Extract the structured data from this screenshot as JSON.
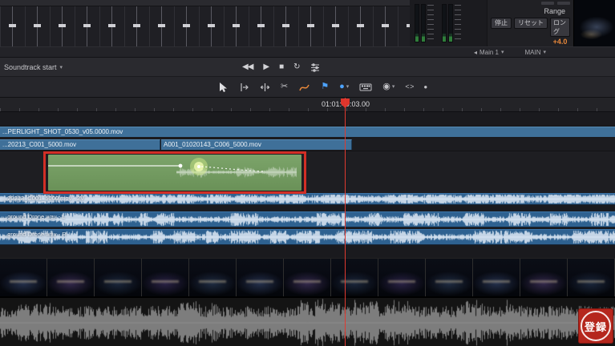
{
  "header": {
    "soundtrack_label": "Soundtrack start",
    "range_label": "Range",
    "stop_button": "停止",
    "reset_button": "リセット",
    "long_button": "ロング",
    "long_value": "+4.0",
    "main1_bus": "Main 1",
    "main_bus": "MAIN"
  },
  "timeline": {
    "timecode": "01:01:49:03.00",
    "tracks": {
      "video1_label": "...PERLIGHT_SHOT_0530_v05.0000.mov",
      "video2_clip1_label": "...20213_C001_5000.mov",
      "video2_clip2_label": "A001_01020143_C006_5000.mov",
      "audio1_label": "...20213_C001_5000.mov - 2V",
      "audio2_label": "...ground Drone.wav - L",
      "audio3_label": "...ground Drone.wav - R"
    }
  },
  "icons": {
    "chevron_down": "▾",
    "rewind": "◀◀",
    "play": "▶",
    "stop": "■",
    "loop": "↻",
    "razor": "✂",
    "flag": "⚑",
    "marker": "●",
    "target": "◉",
    "code": "< >",
    "dot": "●",
    "bus_left": "◂"
  },
  "stamp": {
    "text": "登録"
  },
  "colors": {
    "selection_red": "#d22f26",
    "accent_blue": "#4da3ff",
    "accent_orange": "#e8883a",
    "clip_green": "#74a062",
    "track_blue": "#3f7099",
    "audio_blue": "#2e6190"
  }
}
